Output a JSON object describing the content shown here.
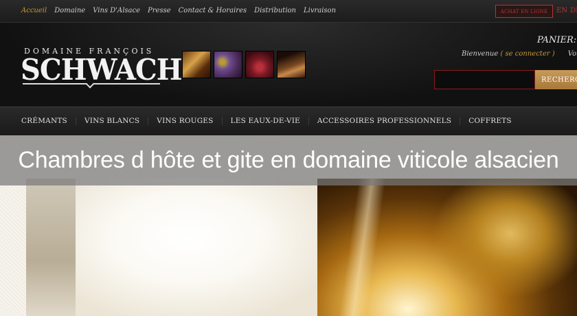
{
  "topnav": {
    "items": [
      "Accueil",
      "Domaine",
      "Vins D'Alsace",
      "Presse",
      "Contact & Horaires",
      "Distribution",
      "Livraison"
    ]
  },
  "achat_label": "ACHAT EN LIGNE",
  "lang": [
    "EN",
    "DE"
  ],
  "logo": {
    "top": "DOMAINE FRANÇOIS",
    "main": "SCHWACH"
  },
  "cart": {
    "label": "PANIER:",
    "paren": "("
  },
  "welcome": {
    "prefix": "Bienvenue",
    "link": "( se connecter )",
    "suffix": "Votre"
  },
  "search": {
    "placeholder": "",
    "button_label": "RECHERCHE"
  },
  "mainnav": {
    "items": [
      "CRÉMANTS",
      "VINS BLANCS",
      "VINS ROUGES",
      "LES EAUX-DE-VIE",
      "ACCESSOIRES PROFESSIONNELS",
      "COFFRETS"
    ]
  },
  "caption": "Chambres d hôte et gite en domaine viticole alsacien",
  "colors": {
    "accent_gold": "#c79a3a",
    "accent_red": "#c0312b",
    "dark_bg": "#1a1a1a"
  }
}
